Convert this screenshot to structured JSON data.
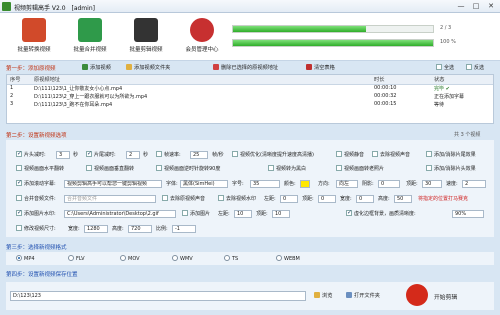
{
  "title": "视频剪辑高手 V2.0",
  "user": "[admin]",
  "window_buttons": [
    "—",
    "□",
    "✕"
  ],
  "toolbar": [
    {
      "label": "批量转换视频",
      "icon": "film-convert-icon",
      "color": "#d14a2a"
    },
    {
      "label": "批量合并视频",
      "icon": "film-merge-icon",
      "color": "#2f9a4a"
    },
    {
      "label": "批量剪辑视频",
      "icon": "clapper-icon",
      "color": "#333333"
    },
    {
      "label": "会员管理中心",
      "icon": "users-icon",
      "color": "#c73030"
    }
  ],
  "progress": [
    {
      "fraction": 0.667,
      "text": "2 / 3"
    },
    {
      "fraction": 1.0,
      "text": "100 %"
    }
  ],
  "step1": {
    "label": "第一步：添加原视频",
    "buttons": [
      "添加视频",
      "添加视频文件夹",
      "删除已选择的原视频地址",
      "清空表格"
    ],
    "select_all": "全选",
    "invert": "反选",
    "columns": [
      "序号",
      "原视频地址",
      "时长",
      "状态"
    ],
    "rows": [
      [
        "1",
        "D:\\111\\123\\1_让你敬友女小心点.mp4",
        "00:00:10",
        "完毕 ✔"
      ],
      [
        "2",
        "D:\\111\\123\\2_穿上一跟衣服就可以为所欲为.mp4",
        "00:00:32",
        "正在添加字幕"
      ],
      [
        "3",
        "D:\\111\\123\\3_跑不在你耳朵.mp4",
        "00:00:15",
        "等待"
      ]
    ],
    "count": "共 3 个视频"
  },
  "step2": {
    "label": "第二步：设置新视频选项",
    "row1": {
      "trim_head": "片头减时:",
      "head_val": "3",
      "sec1": "秒",
      "trim_tail": "片尾减时:",
      "tail_val": "2",
      "sec2": "秒",
      "fps_label": "帧速率:",
      "fps_val": "25",
      "fps_unit": "帧/秒",
      "optimize": "视频优化(清晰度提升速度高清播)",
      "mute": "视频静音",
      "remove_voice": "去除视频声音",
      "add_outro": "添加/消除片尾效果"
    },
    "row2": {
      "flip_h": "视频画面水平翻转",
      "flip_v": "视频画面垂直翻转",
      "rotate_l": "视频画面逆时针旋转90度",
      "to_gray": "视频转为黑白",
      "vintage": "视频画面转老照片",
      "add_intro": "添加/消除片头效果"
    },
    "row3": {
      "add_sub": "添加滚动字幕:",
      "sub_text": "视频剪辑高手可以帮您一键剪辑视频",
      "font_label": "字体:",
      "font_val": "黑体(SimHei)",
      "size_label": "字号:",
      "size_val": "35",
      "color_label": "颜色:",
      "dir_label": "方向:",
      "dir_val": "向左",
      "shadow_label": "阴影:",
      "shadow_val": "0",
      "top_label": "顶距:",
      "top_val": "30",
      "speed_label": "速度:",
      "speed_val": "2"
    },
    "row4": {
      "merge_audio": "合并音频文件:",
      "audio_ph": "合并音频文件",
      "remove_orig": "去除原视频声音",
      "remove_noise": "去除视频水印",
      "left_label": "左距:",
      "left_val": "0",
      "top2_label": "顶距:",
      "top2_val": "0",
      "w_label": "宽度:",
      "w_val": "0",
      "h_label": "高度:",
      "h_val": "50",
      "red_note": "将指定的位置打马赛克"
    },
    "row5": {
      "add_image": "添加图片水印:",
      "image_path": "C:\\Users\\Administrator\\Desktop\\2.gif",
      "keep_ratio": "添加图片",
      "left_label": "左距:",
      "left_val": "10",
      "top_label": "顶距:",
      "top_val": "10",
      "blur_bg": "虚化边框背景，画质清晰度:",
      "blur_val": "90%"
    },
    "row6": {
      "resize": "修改视频尺寸:",
      "w_label": "宽度:",
      "w_val": "1280",
      "h_label": "高度:",
      "h_val": "720",
      "ratio_label": "比例:",
      "ratio_val": "-1"
    }
  },
  "step3": {
    "label": "第三步：选择新视频格式",
    "formats": [
      "MP4",
      "FLV",
      "MOV",
      "WMV",
      "TS",
      "WEBM"
    ],
    "selected": 0
  },
  "step4": {
    "label": "第四步：设置新视频保存位置",
    "path": "D:\\123\\123",
    "browse": "浏览",
    "open": "打开文件夹",
    "start": "开始剪辑"
  }
}
